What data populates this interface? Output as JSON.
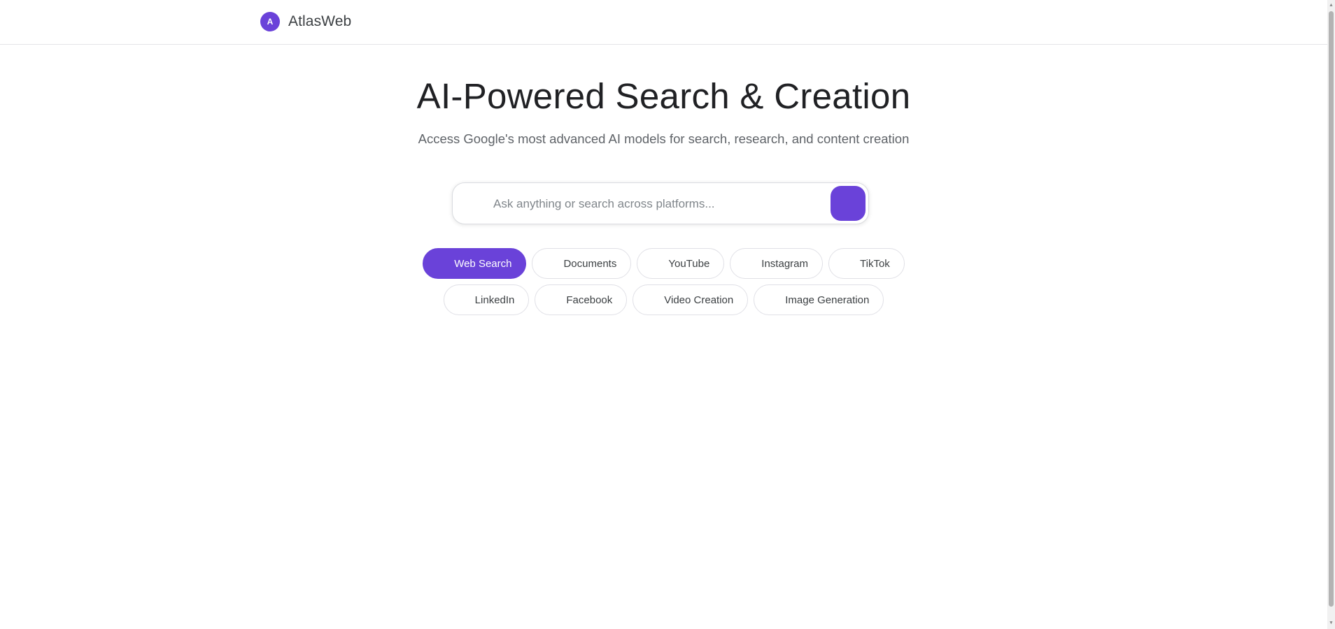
{
  "header": {
    "logo_letter": "A",
    "brand_name": "AtlasWeb"
  },
  "hero": {
    "title": "AI-Powered Search & Creation",
    "subtitle": "Access Google's most advanced AI models for search, research, and content creation"
  },
  "search": {
    "placeholder": "Ask anything or search across platforms...",
    "value": ""
  },
  "modes": {
    "selected": "Web Search",
    "row1": [
      {
        "label": "Web Search",
        "active": true
      },
      {
        "label": "Documents",
        "active": false
      },
      {
        "label": "YouTube",
        "active": false
      },
      {
        "label": "Instagram",
        "active": false
      },
      {
        "label": "TikTok",
        "active": false
      }
    ],
    "row2": [
      {
        "label": "LinkedIn",
        "active": false
      },
      {
        "label": "Facebook",
        "active": false
      },
      {
        "label": "Video Creation",
        "active": false
      },
      {
        "label": "Image Generation",
        "active": false
      }
    ]
  },
  "colors": {
    "accent": "#6a42d9",
    "text_primary": "#202124",
    "text_secondary": "#5f6368",
    "chip_border": "#e0e0e6"
  }
}
